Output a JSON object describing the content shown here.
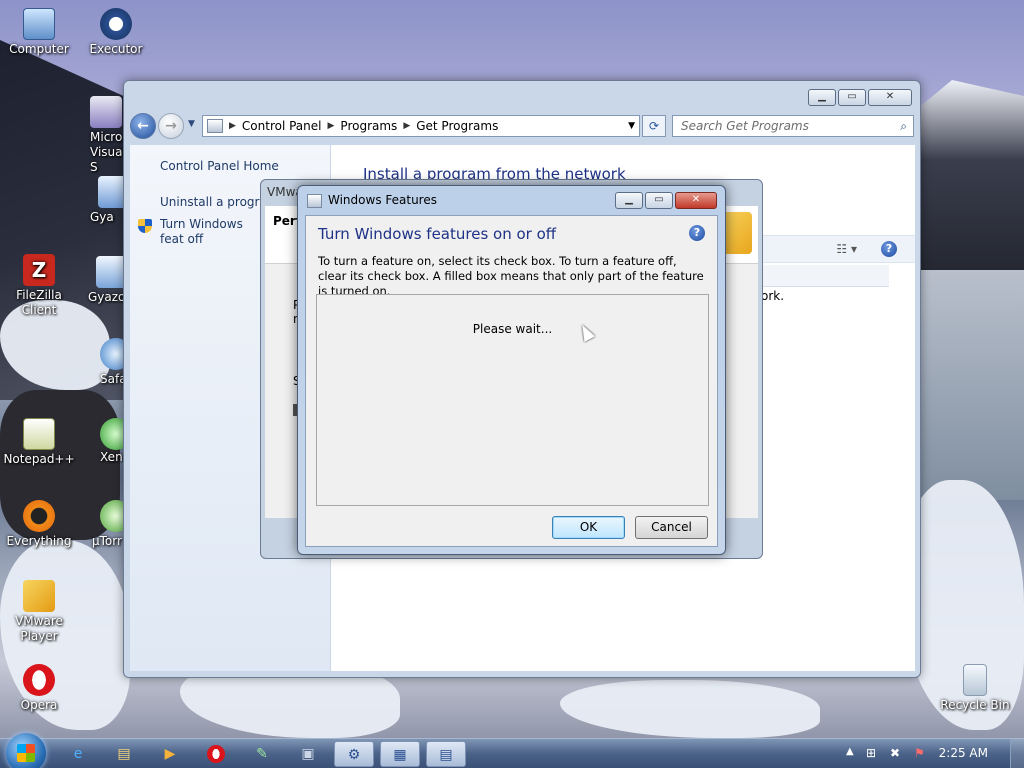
{
  "desktop": {
    "icons": [
      {
        "label": "Computer"
      },
      {
        "label": "Executor"
      },
      {
        "label": "Micro Visual S"
      },
      {
        "label": "Gya"
      },
      {
        "label": "FileZilla Client"
      },
      {
        "label": "Gyazo"
      },
      {
        "label": "Safa"
      },
      {
        "label": "Notepad++"
      },
      {
        "label": "Xen"
      },
      {
        "label": "Everything"
      },
      {
        "label": "µTorr"
      },
      {
        "label": "VMware Player"
      },
      {
        "label": "Opera"
      },
      {
        "label": "Recycle Bin"
      }
    ]
  },
  "explorer": {
    "breadcrumb": [
      "Control Panel",
      "Programs",
      "Get Programs"
    ],
    "search_placeholder": "Search Get Programs",
    "left_links": [
      "Control Panel Home",
      "Uninstall a program",
      "Turn Windows feat off"
    ],
    "title": "Install a program from the network",
    "body_text_fragment": "ork."
  },
  "vmware_dialog": {
    "title": "VMwa",
    "heading": "Perf",
    "fragments": [
      "P",
      "n",
      "S"
    ]
  },
  "windows_features": {
    "title": "Windows Features",
    "heading": "Turn Windows features on or off",
    "description": "To turn a feature on, select its check box. To turn a feature off, clear its check box. A filled box means that only part of the feature is turned on.",
    "status": "Please wait...",
    "ok_label": "OK",
    "cancel_label": "Cancel",
    "help_glyph": "?"
  },
  "taskbar": {
    "clock": "2:25 AM"
  }
}
